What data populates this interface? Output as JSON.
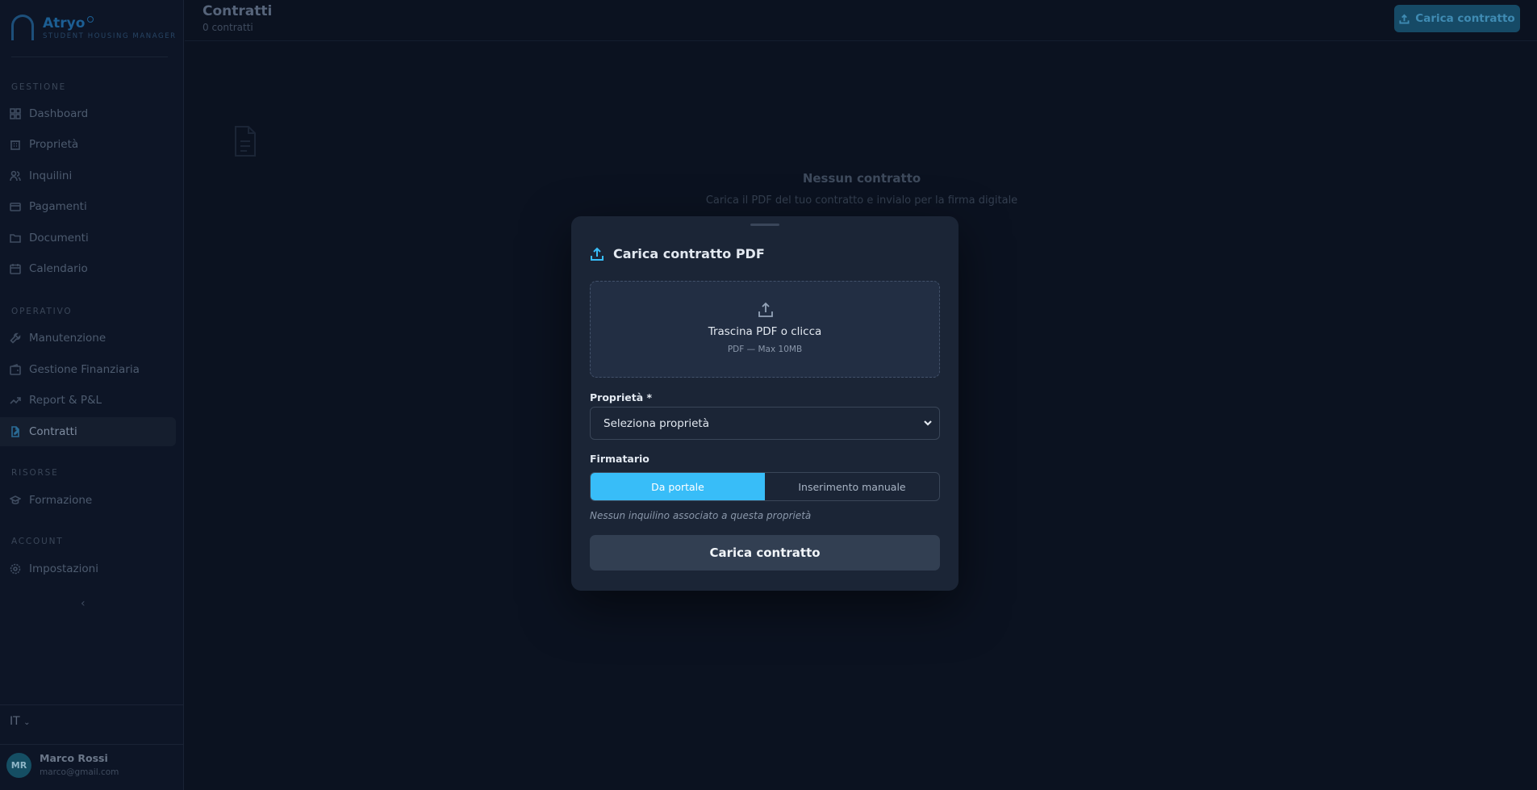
{
  "brand": {
    "name": "Atryo",
    "tagline": "STUDENT HOUSING MANAGER"
  },
  "sidebar": {
    "sections": [
      {
        "label": "GESTIONE"
      },
      {
        "label": "OPERATIVO"
      },
      {
        "label": "RISORSE"
      },
      {
        "label": "ACCOUNT"
      }
    ],
    "items": [
      {
        "label": "Dashboard",
        "icon": "grid-icon"
      },
      {
        "label": "Proprietà",
        "icon": "building-icon"
      },
      {
        "label": "Inquilini",
        "icon": "users-icon"
      },
      {
        "label": "Pagamenti",
        "icon": "credit-card-icon"
      },
      {
        "label": "Documenti",
        "icon": "folder-icon"
      },
      {
        "label": "Calendario",
        "icon": "calendar-icon"
      },
      {
        "label": "Manutenzione",
        "icon": "wrench-icon"
      },
      {
        "label": "Gestione Finanziaria",
        "icon": "wallet-icon"
      },
      {
        "label": "Report & P&L",
        "icon": "trend-icon"
      },
      {
        "label": "Contratti",
        "icon": "file-edit-icon",
        "active": true
      },
      {
        "label": "Formazione",
        "icon": "graduation-cap-icon"
      },
      {
        "label": "Impostazioni",
        "icon": "gear-icon"
      }
    ],
    "collapse_glyph": "‹",
    "language": "IT",
    "user": {
      "initials": "MR",
      "name": "Marco Rossi",
      "email": "marco@gmail.com"
    }
  },
  "header": {
    "title": "Contratti",
    "subtitle": "0 contratti",
    "upload_button": "Carica contratto"
  },
  "empty_state": {
    "title": "Nessun contratto",
    "description": "Carica il PDF del tuo contratto e invialo per la firma digitale"
  },
  "modal": {
    "title": "Carica contratto PDF",
    "dropzone": {
      "main": "Trascina PDF o clicca",
      "sub": "PDF — Max 10MB"
    },
    "property_label": "Proprietà *",
    "property_select": "Seleziona proprietà",
    "signer_label": "Firmatario",
    "signer_options": [
      "Da portale",
      "Inserimento manuale"
    ],
    "signer_selected": "Da portale",
    "note": "Nessun inquilino associato a questa proprietà",
    "submit": "Carica contratto"
  },
  "colors": {
    "accent": "#38bdf8",
    "background": "#0b1220",
    "modal": "#1b2536"
  }
}
